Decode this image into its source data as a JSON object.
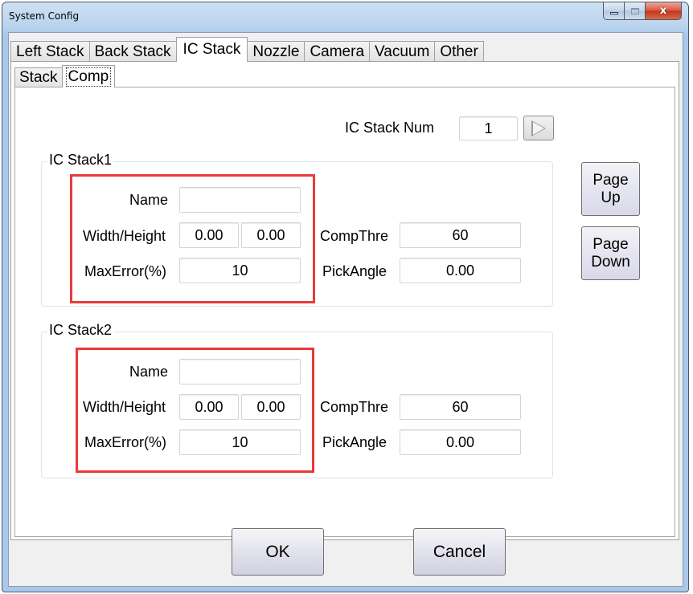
{
  "window": {
    "title": "System Config",
    "controls": {
      "minimize": "minimize-icon",
      "maximize": "maximize-icon",
      "close": "close-icon",
      "close_glyph": "x"
    }
  },
  "tabs": [
    {
      "label": "Left Stack",
      "active": false
    },
    {
      "label": "Back Stack",
      "active": false
    },
    {
      "label": "IC Stack",
      "active": true
    },
    {
      "label": "Nozzle",
      "active": false
    },
    {
      "label": "Camera",
      "active": false
    },
    {
      "label": "Vacuum",
      "active": false
    },
    {
      "label": "Other",
      "active": false
    }
  ],
  "subtabs": [
    {
      "label": "Stack",
      "active": false
    },
    {
      "label": "Comp",
      "active": true
    }
  ],
  "stack_num": {
    "label": "IC Stack Num",
    "value": "1",
    "next_icon": "play-arrow-icon"
  },
  "groups": [
    {
      "title": "IC Stack1",
      "name_label": "Name",
      "name_value": "",
      "wh_label": "Width/Height",
      "width_value": "0.00",
      "height_value": "0.00",
      "maxerr_label": "MaxError(%)",
      "maxerr_value": "10",
      "compthre_label": "CompThre",
      "compthre_value": "60",
      "pickangle_label": "PickAngle",
      "pickangle_value": "0.00"
    },
    {
      "title": "IC Stack2",
      "name_label": "Name",
      "name_value": "",
      "wh_label": "Width/Height",
      "width_value": "0.00",
      "height_value": "0.00",
      "maxerr_label": "MaxError(%)",
      "maxerr_value": "10",
      "compthre_label": "CompThre",
      "compthre_value": "60",
      "pickangle_label": "PickAngle",
      "pickangle_value": "0.00"
    }
  ],
  "side_buttons": {
    "page_up": "Page\nUp",
    "page_down": "Page\nDown"
  },
  "footer": {
    "ok": "OK",
    "cancel": "Cancel"
  },
  "colors": {
    "highlight": "#ea3a3a"
  }
}
